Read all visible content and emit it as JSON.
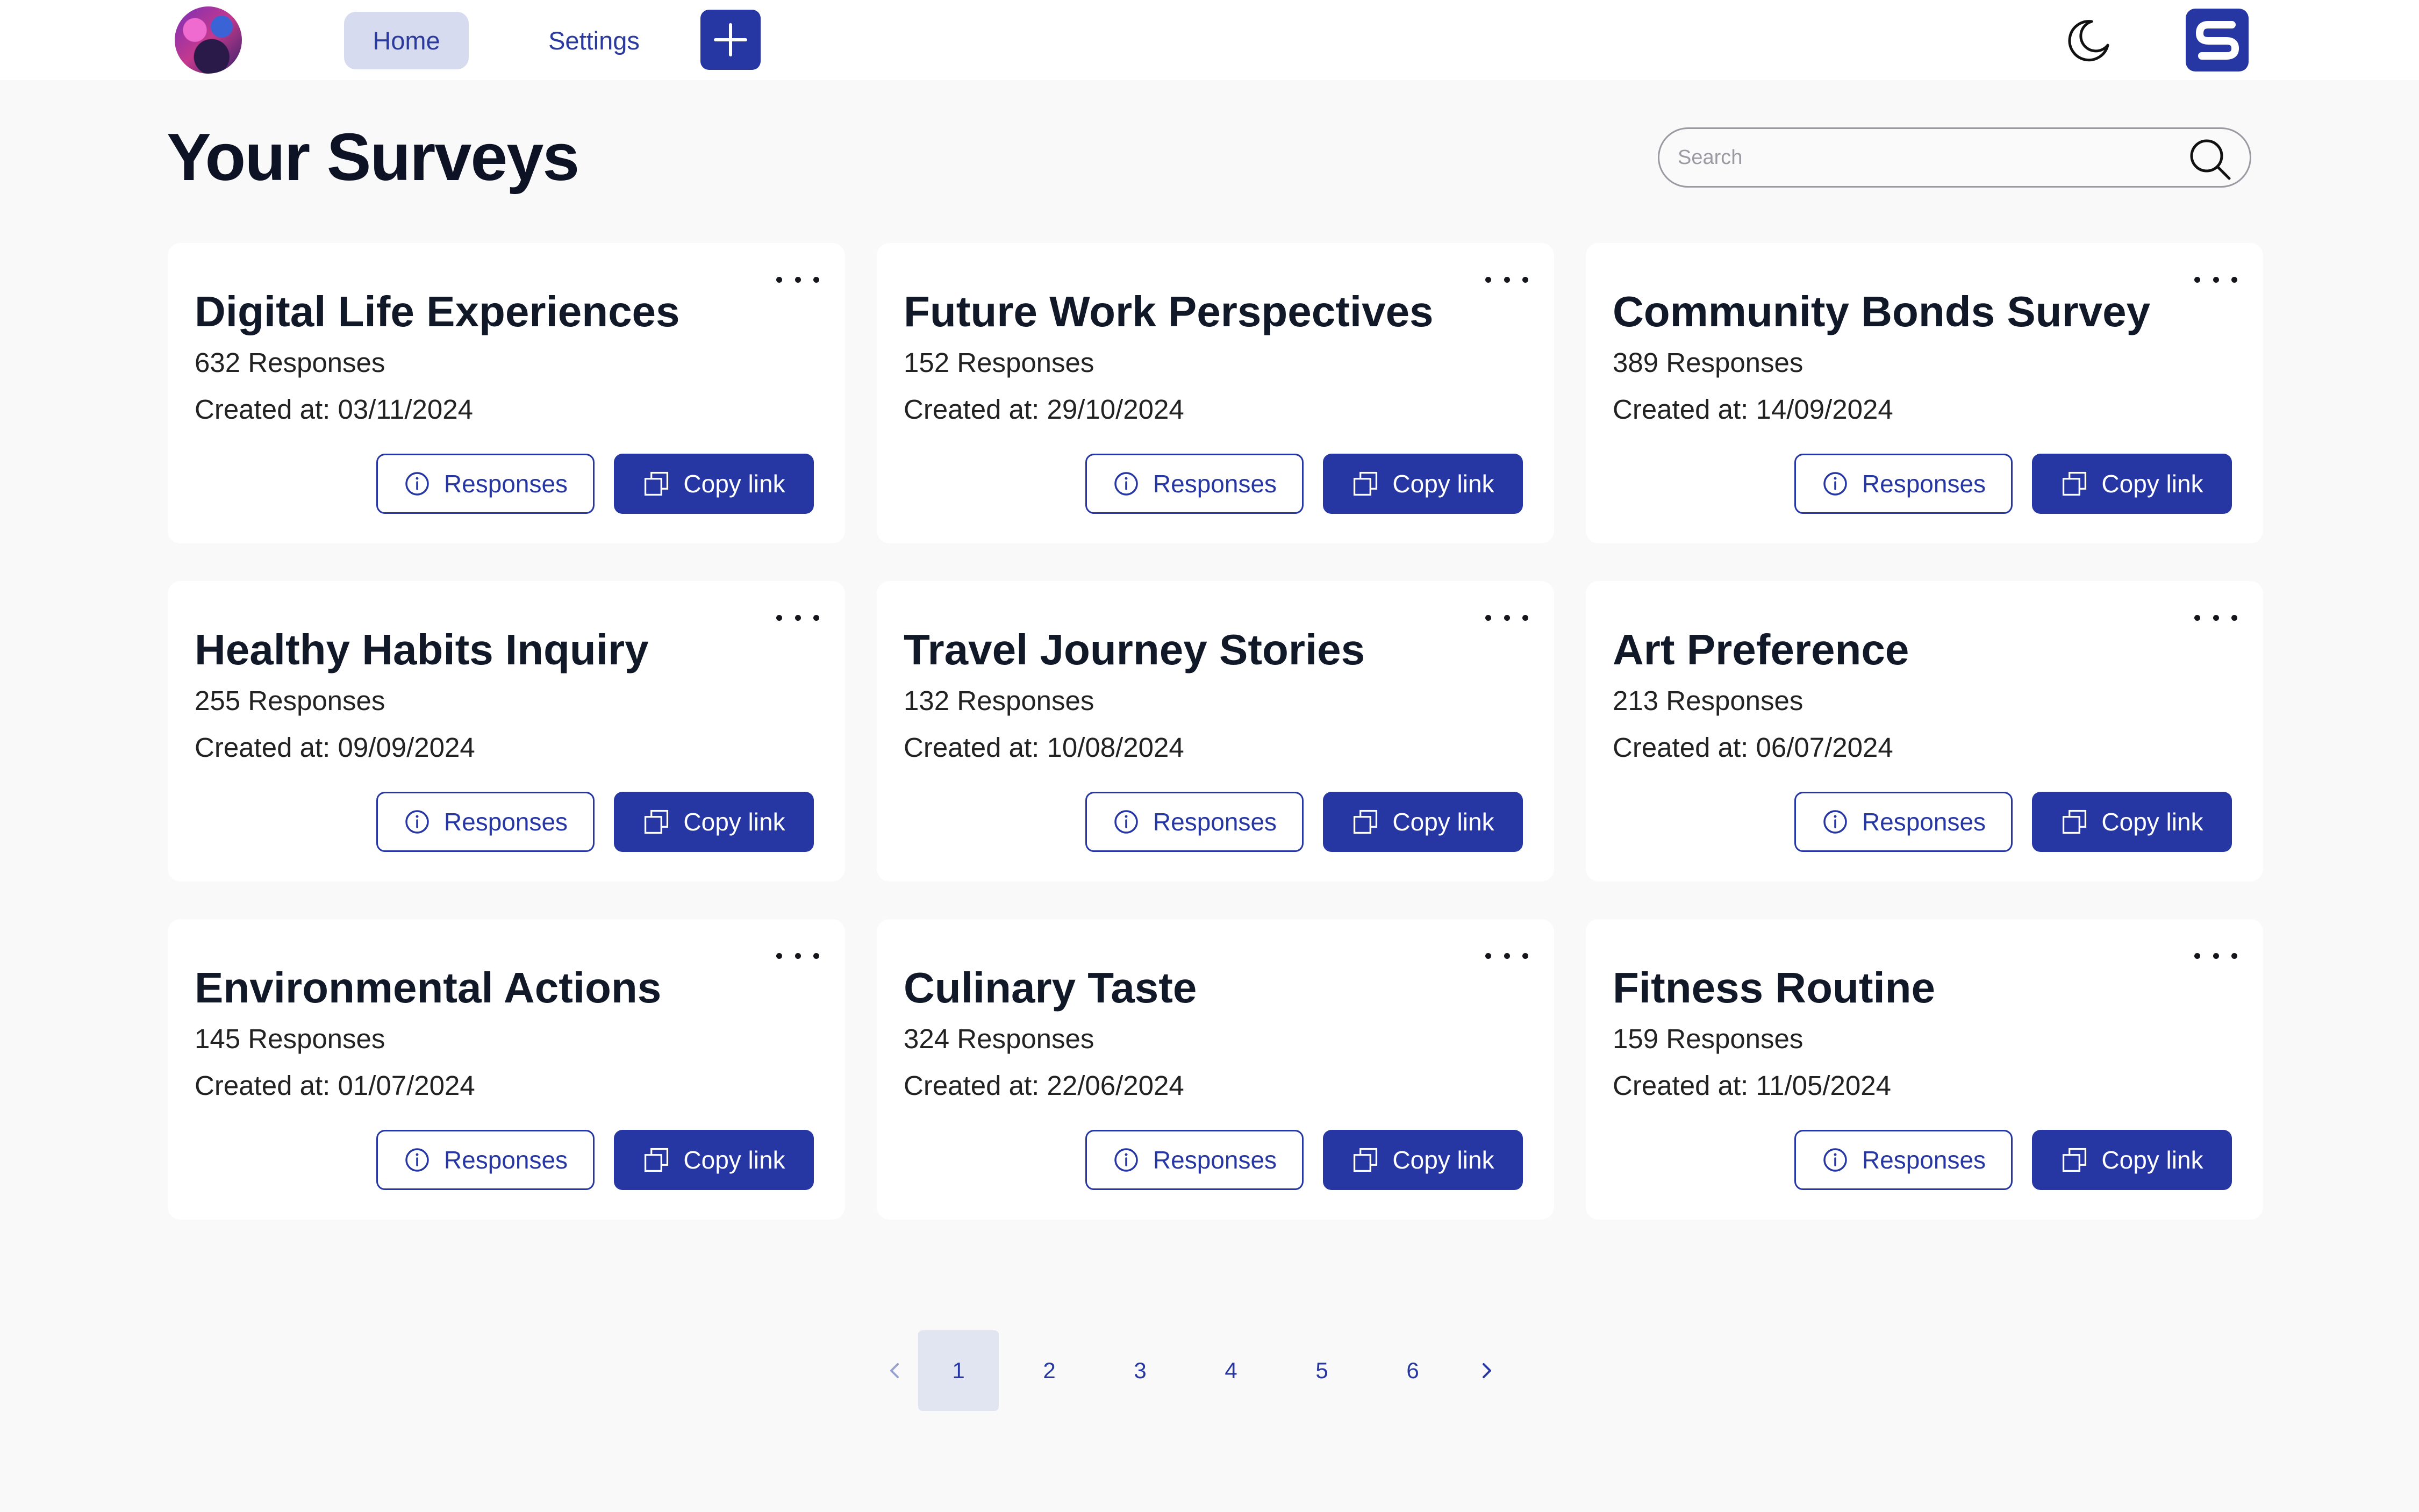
{
  "nav": {
    "tabs": [
      {
        "label": "Home",
        "active": true
      },
      {
        "label": "Settings",
        "active": false
      }
    ],
    "add_icon": "plus-icon",
    "theme_icon": "moon-icon",
    "brand_icon": "s-logo"
  },
  "page": {
    "title": "Your Surveys",
    "search_placeholder": "Search"
  },
  "buttons": {
    "responses_label": "Responses",
    "copy_label": "Copy link"
  },
  "surveys": [
    {
      "title": "Digital Life Experiences",
      "responses": "632 Responses",
      "created": "Created at: 03/11/2024"
    },
    {
      "title": "Future Work Perspectives",
      "responses": "152 Responses",
      "created": "Created at: 29/10/2024"
    },
    {
      "title": "Community Bonds Survey",
      "responses": "389 Responses",
      "created": "Created at: 14/09/2024"
    },
    {
      "title": "Healthy Habits Inquiry",
      "responses": "255 Responses",
      "created": "Created at: 09/09/2024"
    },
    {
      "title": "Travel Journey Stories",
      "responses": "132 Responses",
      "created": "Created at: 10/08/2024"
    },
    {
      "title": "Art Preference",
      "responses": "213 Responses",
      "created": "Created at: 06/07/2024"
    },
    {
      "title": "Environmental Actions",
      "responses": "145 Responses",
      "created": "Created at: 01/07/2024"
    },
    {
      "title": "Culinary Taste",
      "responses": "324 Responses",
      "created": "Created at: 22/06/2024"
    },
    {
      "title": "Fitness Routine",
      "responses": "159 Responses",
      "created": "Created at: 11/05/2024"
    }
  ],
  "pagination": {
    "pages": [
      "1",
      "2",
      "3",
      "4",
      "5",
      "6"
    ],
    "current": "1"
  },
  "colors": {
    "primary": "#2637a3",
    "active_tab_bg": "#d6dbef",
    "background": "#f9f9f9",
    "card": "#ffffff"
  }
}
